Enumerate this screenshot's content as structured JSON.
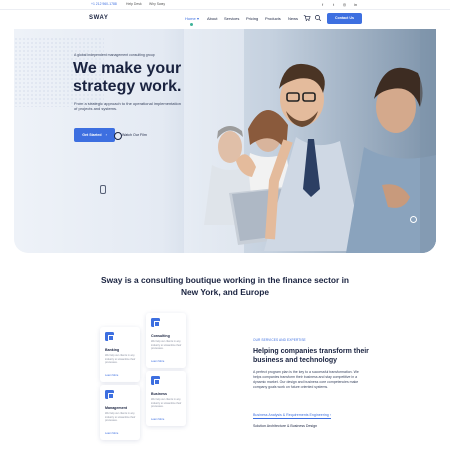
{
  "topbar": {
    "phone": "+1 212 960-1788",
    "help": "Help Desk",
    "why": "Why Sway",
    "social_icons": [
      "facebook-icon",
      "twitter-icon",
      "instagram-icon",
      "linkedin-icon"
    ]
  },
  "nav": {
    "logo": "SWAY",
    "items": [
      "Home",
      "About",
      "Services",
      "Pricing",
      "Products",
      "News"
    ],
    "cta": "Contact Us"
  },
  "hero": {
    "eyebrow": "A global independent management consulting group",
    "headline": "We make your strategy work.",
    "subtitle": "From a strategic approach to the operational implementation of projects and systems.",
    "primary_button": "Get Started",
    "secondary_button": "Watch Our Film"
  },
  "tagline": "Sway is a consulting boutique working in the finance sector in New York, and Europe",
  "cards": [
    {
      "title": "Banking",
      "desc": "We help our clients in any industry to streamline their processes.",
      "more": "Learn More"
    },
    {
      "title": "Consulting",
      "desc": "We help our clients in any industry to streamline their processes.",
      "more": "Learn More"
    },
    {
      "title": "Management",
      "desc": "We help our clients in any industry to streamline their processes.",
      "more": "Learn More"
    },
    {
      "title": "Business",
      "desc": "We help our clients in any industry to streamline their processes.",
      "more": "Learn More"
    }
  ],
  "expertise": {
    "eyebrow": "OUR SERVICES AND EXPERTISE",
    "title": "Helping companies transform their business and technology",
    "paragraph": "A perfect program plan is the key to a successful transformation. We helps companies transform their business and stay competitive in a dynamic market. Our design and business core competencies make company goals work on future oriented systems.",
    "link_primary": "Business Analysis & Requirements Engineering",
    "link_secondary": "Solution Architecture & Business Design"
  },
  "colors": {
    "accent": "#3d6fe0",
    "dark": "#1a2340",
    "green": "#3fb39a"
  }
}
